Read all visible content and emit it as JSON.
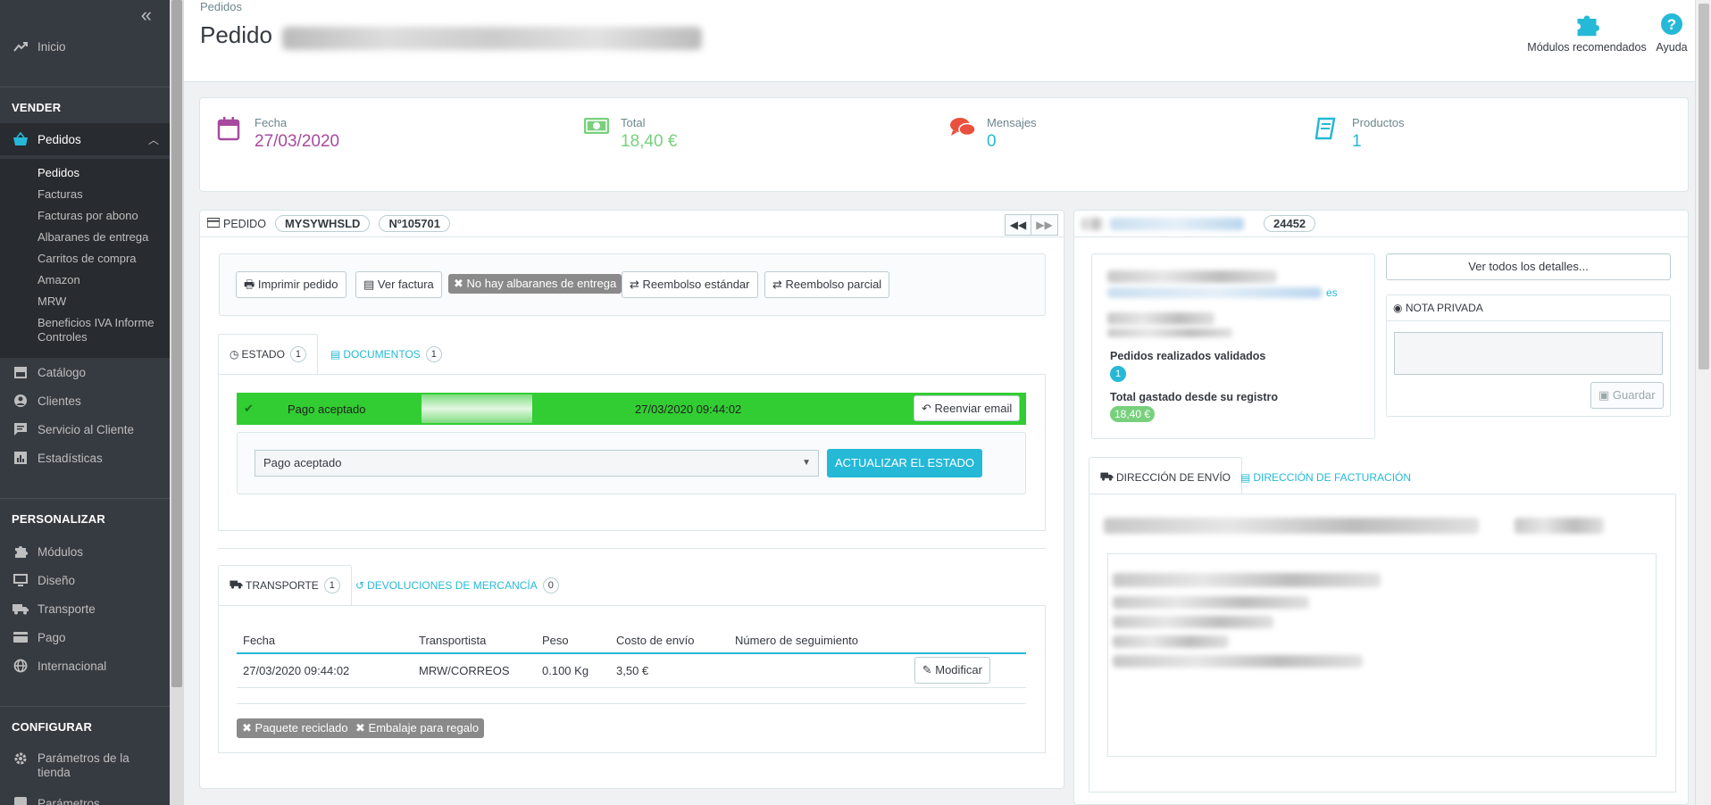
{
  "sidebar": {
    "top_item": "Inicio",
    "sections": {
      "sell": "VENDER",
      "customize": "PERSONALIZAR",
      "configure": "CONFIGURAR"
    },
    "orders_label": "Pedidos",
    "orders_sub": [
      "Pedidos",
      "Facturas",
      "Facturas por abono",
      "Albaranes de entrega",
      "Carritos de compra",
      "Amazon",
      "MRW",
      "Beneficios IVA Informe Controles"
    ],
    "sell_items": [
      "Catálogo",
      "Clientes",
      "Servicio al Cliente",
      "Estadísticas"
    ],
    "customize_items": [
      "Módulos",
      "Diseño",
      "Transporte",
      "Pago",
      "Internacional"
    ],
    "configure_items": [
      "Parámetros de la tienda",
      "Parámetros"
    ]
  },
  "header": {
    "breadcrumb": "Pedidos",
    "title": "Pedido",
    "recommended_modules": "Módulos recomendados",
    "help": "Ayuda"
  },
  "kpis": {
    "date_label": "Fecha",
    "date_value": "27/03/2020",
    "total_label": "Total",
    "total_value": "18,40 €",
    "messages_label": "Mensajes",
    "messages_value": "0",
    "products_label": "Productos",
    "products_value": "1"
  },
  "colors": {
    "date": "#a74a9f",
    "total": "#78d07d",
    "messages": "#e9503d",
    "products": "#25b9d7",
    "accent": "#25b9d7",
    "status": "#32cd32"
  },
  "order": {
    "heading": "PEDIDO",
    "reference": "MYSYWHSLD",
    "number": "Nº105701",
    "actions": [
      "Imprimir pedido",
      "Ver factura",
      "No hay albaranes de entrega",
      "Reembolso estándar",
      "Reembolso parcial"
    ],
    "tabs": {
      "status": "ESTADO",
      "status_count": "1",
      "documents": "DOCUMENTOS",
      "documents_count": "1"
    },
    "status_row": {
      "label": "Pago aceptado",
      "date": "27/03/2020 09:44:02",
      "resend": "Reenviar email"
    },
    "status_select": "Pago aceptado",
    "update_status": "ACTUALIZAR EL ESTADO",
    "shipping_tabs": {
      "transport": "TRANSPORTE",
      "transport_count": "1",
      "returns": "DEVOLUCIONES DE MERCANCÍA",
      "returns_count": "0"
    },
    "shipping_table": {
      "headers": [
        "Fecha",
        "Transportista",
        "Peso",
        "Costo de envío",
        "Número de seguimiento",
        ""
      ],
      "row": {
        "date": "27/03/2020 09:44:02",
        "carrier": "MRW/CORREOS",
        "weight": "0.100 Kg",
        "cost": "3,50 €",
        "tracking": "",
        "edit": "Modificar"
      }
    },
    "tags": [
      "Paquete reciclado",
      "Embalaje para regalo"
    ]
  },
  "customer": {
    "id_fragment": "24452",
    "link_fragment": "es",
    "validated_orders_label": "Pedidos realizados validados",
    "validated_orders": "1",
    "total_spent_label": "Total gastado desde su registro",
    "total_spent": "18,40 €",
    "view_details": "Ver todos los detalles...",
    "private_note": "NOTA PRIVADA",
    "save": "Guardar",
    "tab_shipping": "DIRECCIÓN DE ENVÍO",
    "tab_invoice": "DIRECCIÓN DE FACTURACIÓN"
  }
}
